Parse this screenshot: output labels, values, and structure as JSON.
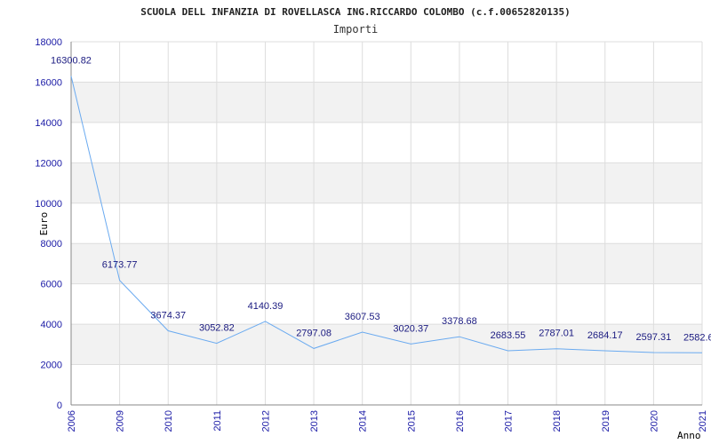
{
  "chart_data": {
    "type": "line",
    "title": "SCUOLA DELL INFANZIA DI ROVELLASCA ING.RICCARDO COLOMBO (c.f.00652820135)",
    "subtitle": "Importi",
    "ylabel": "Euro",
    "xlabel": "Anno",
    "categories": [
      "2006",
      "2009",
      "2010",
      "2011",
      "2012",
      "2013",
      "2014",
      "2015",
      "2016",
      "2017",
      "2018",
      "2019",
      "2020",
      "2021"
    ],
    "values": [
      16300.82,
      6173.77,
      3674.37,
      3052.82,
      4140.39,
      2797.08,
      3607.53,
      3020.37,
      3378.68,
      2683.55,
      2787.01,
      2684.17,
      2597.31,
      2582.6
    ],
    "data_labels": [
      "16300.82",
      "6173.77",
      "3674.37",
      "3052.82",
      "4140.39",
      "2797.08",
      "3607.53",
      "3020.37",
      "3378.68",
      "2683.55",
      "2787.01",
      "2684.17",
      "2597.31",
      "2582.6"
    ],
    "yticks": [
      "0",
      "2000",
      "4000",
      "6000",
      "8000",
      "10000",
      "12000",
      "14000",
      "16000",
      "18000"
    ],
    "ylim": [
      0,
      18000
    ],
    "grid": true,
    "colors": {
      "line": "#6aaaf0",
      "band": "#f2f2f2",
      "grid": "#dddddd",
      "axis": "#888888",
      "tick_text": "#1a1aa6"
    }
  }
}
